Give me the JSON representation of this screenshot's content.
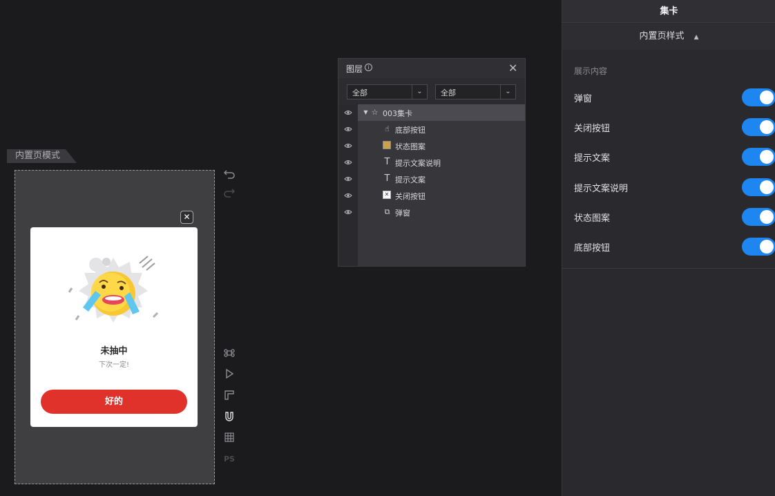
{
  "editor": {
    "mode_tab": "内置页模式"
  },
  "modal": {
    "title": "未抽中",
    "subtitle": "下次一定!",
    "button": "好的",
    "close_glyph": "✕",
    "accent": "#e0322a"
  },
  "tools": {
    "ps_label": "PS"
  },
  "layers": {
    "title": "图层",
    "filter1": "全部",
    "filter2": "全部",
    "items": [
      {
        "label": "003集卡",
        "icon": "star-icon"
      },
      {
        "label": "底部按钮",
        "icon": "pointer-icon"
      },
      {
        "label": "状态图案",
        "icon": "image-icon"
      },
      {
        "label": "提示文案说明",
        "icon": "text-icon"
      },
      {
        "label": "提示文案",
        "icon": "text-icon"
      },
      {
        "label": "关闭按钮",
        "icon": "close-image-icon"
      },
      {
        "label": "弹窗",
        "icon": "window-icon"
      }
    ]
  },
  "panel": {
    "title": "集卡",
    "subtitle": "内置页样式",
    "section": "展示内容",
    "toggle_color": "#1e86f0",
    "toggles": [
      {
        "label": "弹窗",
        "on": true
      },
      {
        "label": "关闭按钮",
        "on": true
      },
      {
        "label": "提示文案",
        "on": true
      },
      {
        "label": "提示文案说明",
        "on": true
      },
      {
        "label": "状态图案",
        "on": true
      },
      {
        "label": "底部按钮",
        "on": true
      }
    ]
  }
}
